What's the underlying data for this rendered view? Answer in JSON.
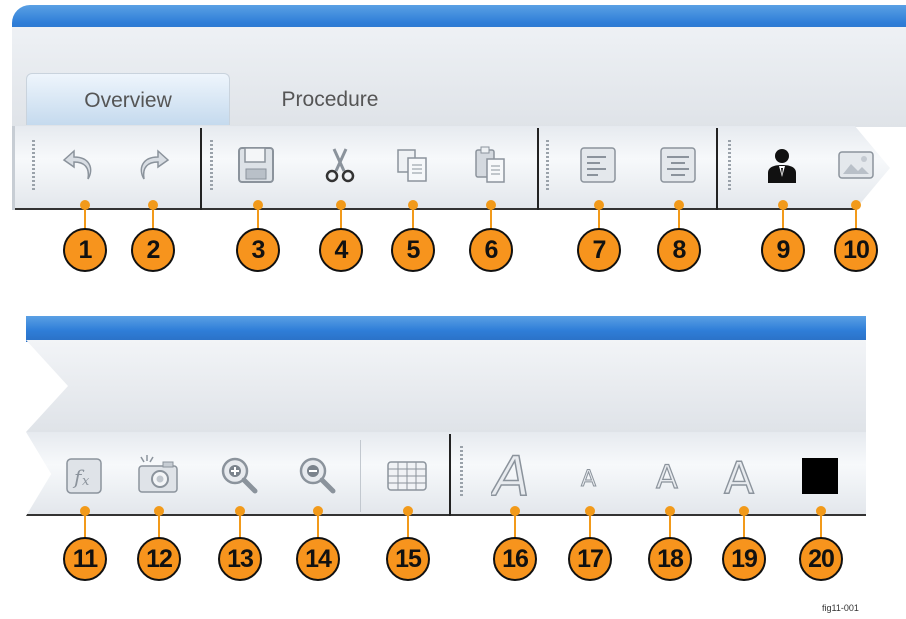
{
  "tabs": [
    {
      "label": "Overview",
      "active": true
    },
    {
      "label": "Procedure",
      "active": false
    }
  ],
  "toolbar_top_icons": [
    "undo-icon",
    "redo-icon",
    "save-icon",
    "cut-icon",
    "copy-icon",
    "paste-icon",
    "align-left-icon",
    "align-center-icon",
    "user-icon",
    "picture-icon"
  ],
  "toolbar_bottom_icons": [
    "function-icon",
    "camera-icon",
    "zoom-in-icon",
    "zoom-out-icon",
    "table-icon",
    "font-italic-icon",
    "font-small-icon",
    "font-medium-icon",
    "font-large-icon",
    "color-swatch-icon"
  ],
  "callouts": [
    "1",
    "2",
    "3",
    "4",
    "5",
    "6",
    "7",
    "8",
    "9",
    "10",
    "11",
    "12",
    "13",
    "14",
    "15",
    "16",
    "17",
    "18",
    "19",
    "20"
  ],
  "figure_label": "fig11-001",
  "colors": {
    "accent_blue": "#2f7ed8",
    "callout_orange": "#f7941d",
    "swatch_black": "#000000"
  }
}
